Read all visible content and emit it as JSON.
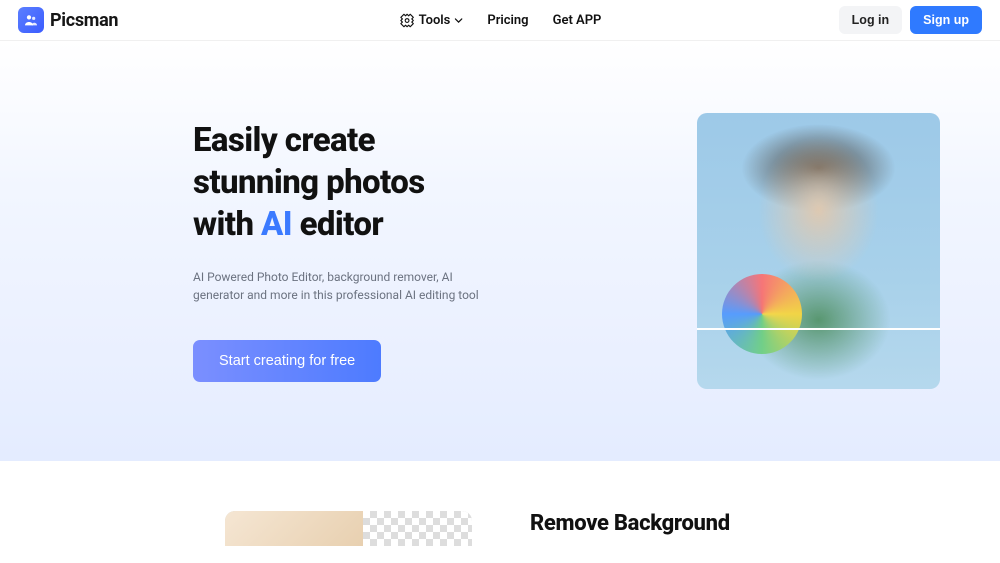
{
  "brand": {
    "name": "Picsman"
  },
  "nav": {
    "tools": "Tools",
    "pricing": "Pricing",
    "getApp": "Get APP"
  },
  "auth": {
    "login": "Log in",
    "signup": "Sign up"
  },
  "hero": {
    "title_line1": "Easily create",
    "title_line2": "stunning photos",
    "title_line3_prefix": "with ",
    "title_line3_ai": "AI",
    "title_line3_suffix": " editor",
    "subtitle": "AI Powered Photo Editor, background remover, AI generator and more in this professional AI editing tool",
    "cta": "Start creating for free"
  },
  "feature": {
    "title": "Remove Background"
  }
}
